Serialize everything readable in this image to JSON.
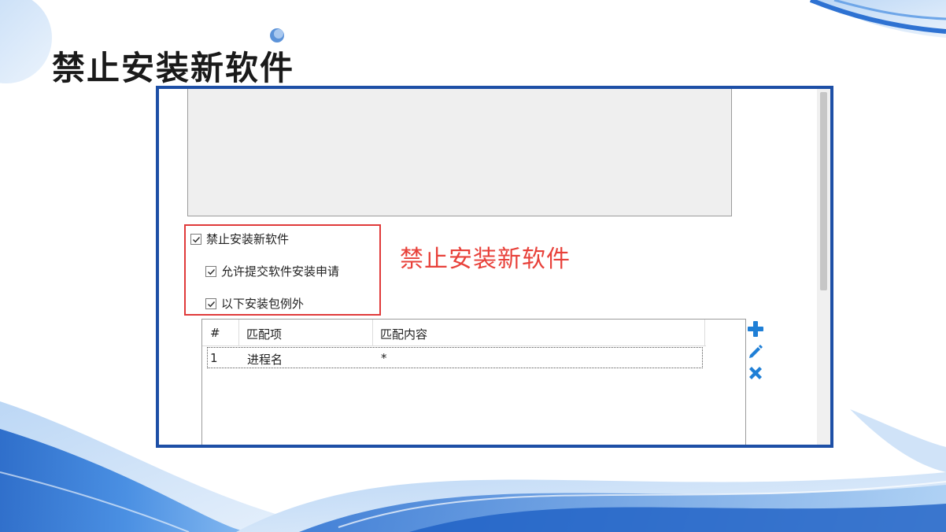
{
  "slide": {
    "title": "禁止安装新软件",
    "accent_color": "#1d4fa6"
  },
  "settings": {
    "block_new_software": {
      "label": "禁止安装新软件",
      "checked": true
    },
    "allow_request": {
      "label": "允许提交软件安装申请",
      "checked": true
    },
    "exceptions": {
      "label": "以下安装包例外",
      "checked": true
    }
  },
  "annotation": {
    "text": "禁止安装新软件",
    "color": "#e8413a"
  },
  "exception_table": {
    "columns": [
      "#",
      "匹配项",
      "匹配内容"
    ],
    "rows": [
      [
        "1",
        "进程名",
        "*"
      ]
    ]
  },
  "toolbar": {
    "icons": [
      "add-icon",
      "edit-icon",
      "delete-icon"
    ]
  }
}
